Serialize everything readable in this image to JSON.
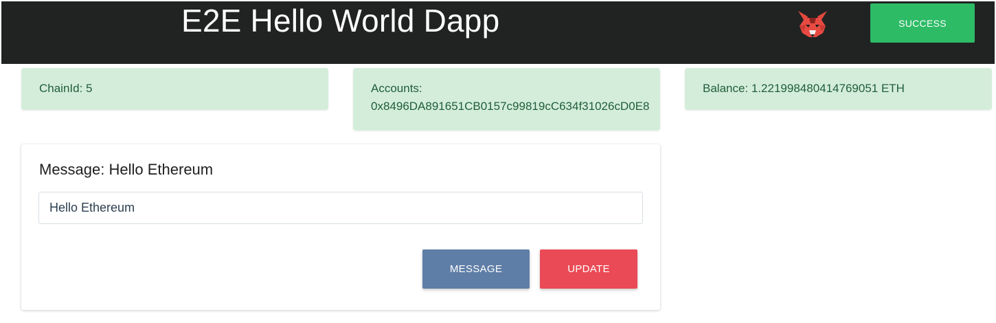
{
  "header": {
    "title": "E2E Hello World Dapp",
    "wallet_icon": "metamask-fox-icon",
    "status_label": "SUCCESS",
    "background_color": "#212322",
    "status_color": "#2dbb66"
  },
  "info": {
    "chain": "ChainId: 5",
    "accounts_label": "Accounts:",
    "accounts_value": "0x8496DA891651CB0157c99819cC634f31026cD0E8",
    "balance": "Balance: 1.221998480414769051 ETH",
    "card_color": "#d4edda"
  },
  "message_panel": {
    "heading": "Message: Hello Ethereum",
    "input_value": "Hello Ethereum",
    "message_button": "MESSAGE",
    "update_button": "UPDATE",
    "message_button_color": "#5f7ea7",
    "update_button_color": "#ea4a55"
  }
}
